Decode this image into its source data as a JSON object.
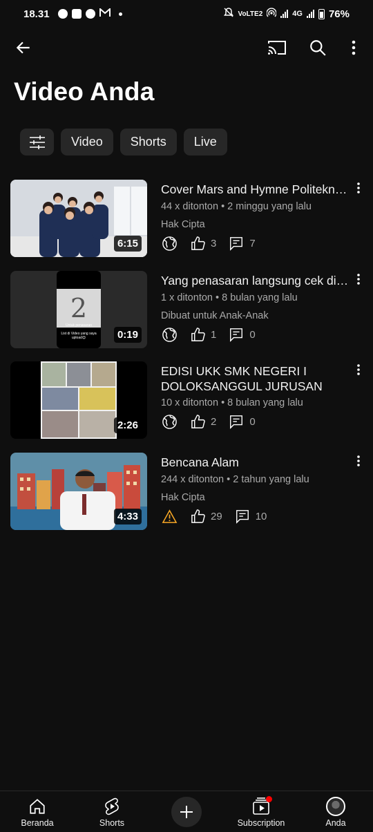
{
  "status_bar": {
    "time": "18.31",
    "network": "4G",
    "volte": "VoLTE2",
    "battery": "76%"
  },
  "header": {
    "title": "Video Anda"
  },
  "chips": [
    {
      "label": "Video"
    },
    {
      "label": "Shorts"
    },
    {
      "label": "Live"
    }
  ],
  "videos": [
    {
      "title": "Cover Mars and Hymne Politeknik Negeri",
      "duration": "6:15",
      "stats": "44 x ditonton • 2 minggu yang lalu",
      "note": "Hak Cipta",
      "likes": "3",
      "comments": "7"
    },
    {
      "title": "Yang penasaran langsung cek di list",
      "duration": "0:19",
      "stats": "1 x ditonton • 8 bulan yang lalu",
      "note": "Dibuat untuk Anak-Anak",
      "likes": "1",
      "comments": "0",
      "thumb_number": "2",
      "thumb_caption_1": "Untuk penasaran",
      "thumb_caption_2": "List di Video yang saya upload😊"
    },
    {
      "title": "EDISI UKK SMK NEGERI I DOLOKSANGGUL JURUSAN TEKNIK",
      "duration": "2:26",
      "stats": "10 x ditonton • 8 bulan yang lalu",
      "likes": "2",
      "comments": "0"
    },
    {
      "title": "Bencana Alam",
      "duration": "4:33",
      "stats": "244 x ditonton • 2 tahun yang lalu",
      "note": "Hak Cipta",
      "likes": "29",
      "comments": "10"
    }
  ],
  "bottom_nav": {
    "home": "Beranda",
    "shorts": "Shorts",
    "subscription": "Subscription",
    "you": "Anda"
  },
  "colors": {
    "background": "#0f0f0f",
    "chip": "#272727",
    "warning": "#f9a825",
    "notification": "#ff0000"
  }
}
